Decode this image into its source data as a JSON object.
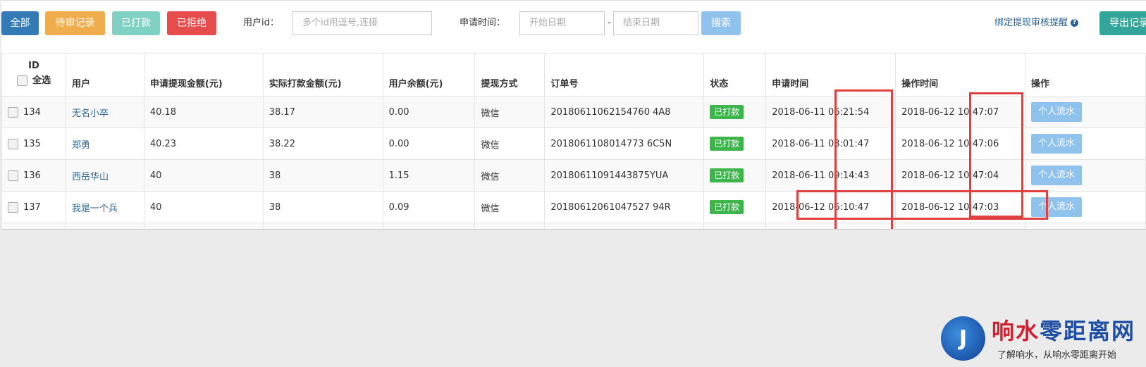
{
  "toolbar": {
    "btn_all": "全部",
    "btn_pending": "待审记录",
    "btn_paid": "已打款",
    "btn_rejected": "已拒绝",
    "user_id_label": "用户id：",
    "user_id_placeholder": "多个id用逗号,连接",
    "apply_time_label": "申请时间：",
    "start_placeholder": "开始日期",
    "dash": "-",
    "end_placeholder": "结束日期",
    "search": "搜索",
    "bind_link": "绑定提现审核提醒",
    "help_icon": "?",
    "export": "导出记录"
  },
  "table": {
    "headers": {
      "id": "ID",
      "select_all": "全选",
      "user": "用户",
      "apply_amount": "申请提现金额(元)",
      "actual_amount": "实际打款金额(元)",
      "balance": "用户余额(元)",
      "method": "提现方式",
      "order_no": "订单号",
      "status": "状态",
      "apply_time": "申请时间",
      "op_time": "操作时间",
      "action": "操作"
    },
    "rows": [
      {
        "id": "134",
        "user": "无名小卒",
        "apply": "40.18",
        "actual": "38.17",
        "balance": "0.00",
        "method": "微信",
        "order": "20180611062154760 4A8",
        "status": "已打款",
        "apply_time": "2018-06-11 06:21:54",
        "op_time": "2018-06-12 10:47:07",
        "action": "个人流水"
      },
      {
        "id": "135",
        "user": "郑勇",
        "apply": "40.23",
        "actual": "38.22",
        "balance": "0.00",
        "method": "微信",
        "order": "2018061108014773 6C5N",
        "status": "已打款",
        "apply_time": "2018-06-11 08:01:47",
        "op_time": "2018-06-12 10:47:06",
        "action": "个人流水"
      },
      {
        "id": "136",
        "user": "西岳华山",
        "apply": "40",
        "actual": "38",
        "balance": "1.15",
        "method": "微信",
        "order": "20180611091443875YUA",
        "status": "已打款",
        "apply_time": "2018-06-11 09:14:43",
        "op_time": "2018-06-12 10:47:04",
        "action": "个人流水"
      },
      {
        "id": "137",
        "user": "我是一个兵",
        "apply": "40",
        "actual": "38",
        "balance": "0.09",
        "method": "微信",
        "order": "20180612061047527 94R",
        "status": "已打款",
        "apply_time": "2018-06-12 06:10:47",
        "op_time": "2018-06-12 10:47:03",
        "action": "个人流水"
      }
    ]
  },
  "watermark": {
    "logo_glyph": "J",
    "title_part1": "响水",
    "title_part2": "零距离网",
    "subtitle": "了解响水，从响水零距离开始"
  }
}
